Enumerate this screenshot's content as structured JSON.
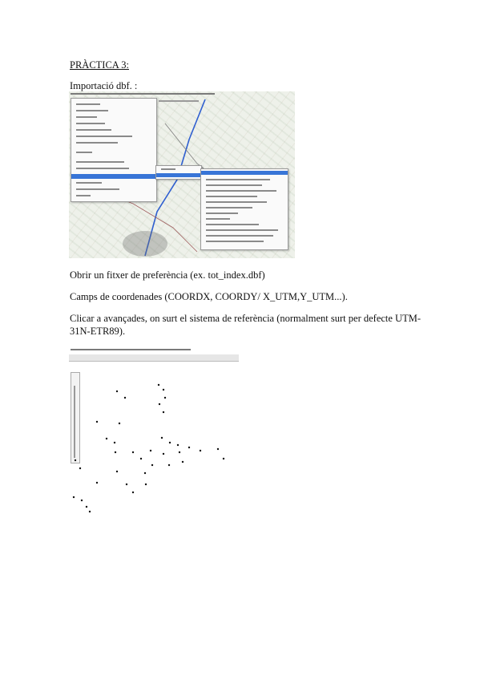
{
  "doc": {
    "title": "PRÀCTICA 3:",
    "import_label": "Importació dbf. :",
    "para1": "Obrir un fitxer de preferència (ex. tot_index.dbf)",
    "para2": "Camps de coordenades (COORDX, COORDY/ X_UTM,Y_UTM...).",
    "para3_line1": "Clicar a avançades, on surt el sistema de referència (normalment surt per defecte UTM-",
    "para3_line2": "31N-ETR89)."
  },
  "colors": {
    "menu_highlight": "#3875d7",
    "map_road": "#2f5fd0"
  }
}
